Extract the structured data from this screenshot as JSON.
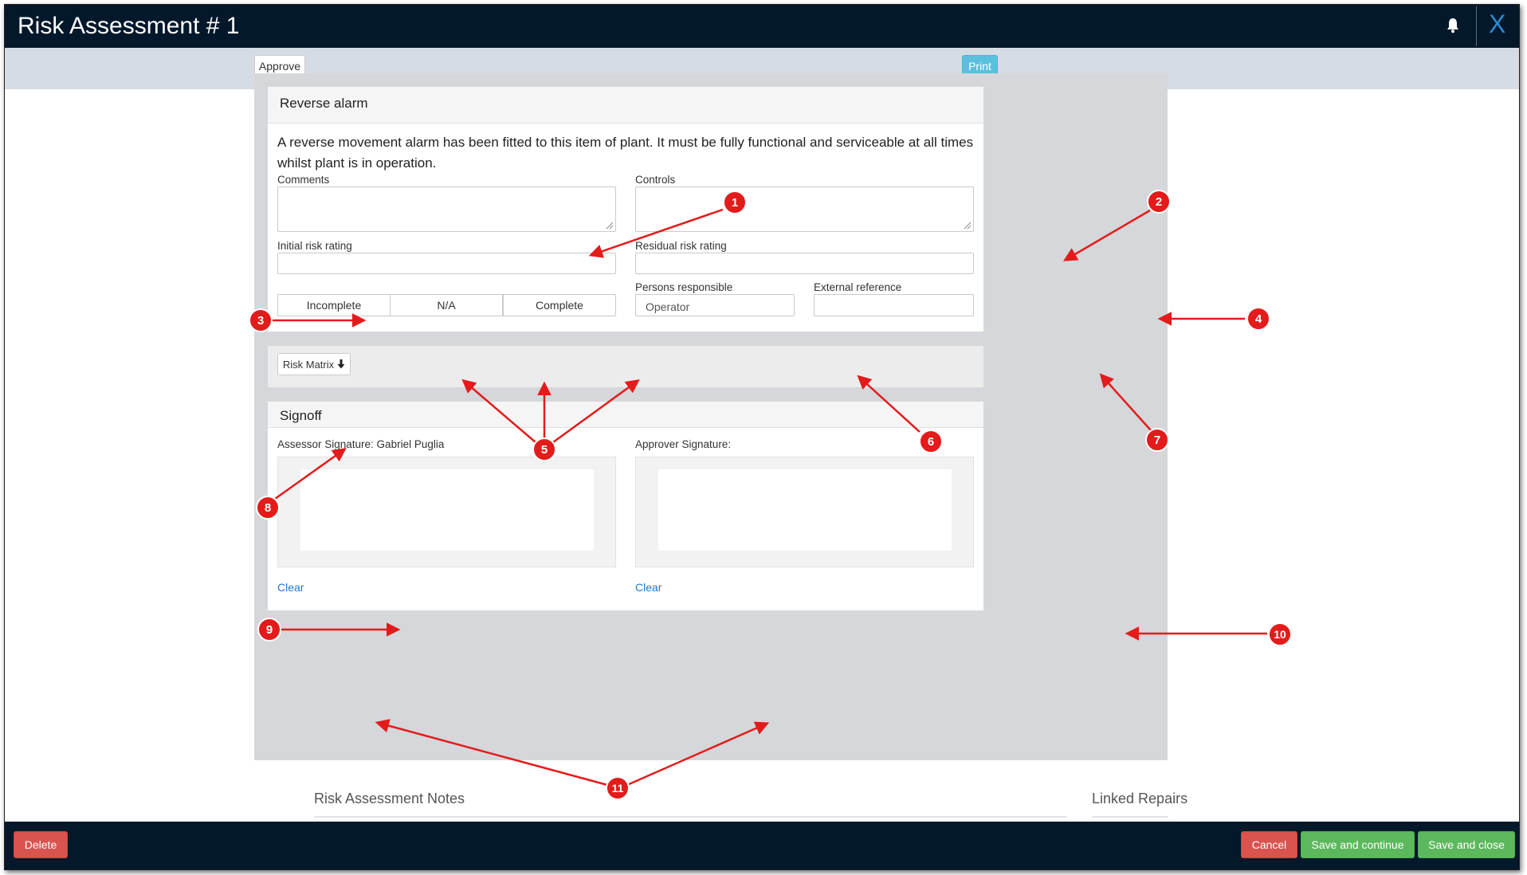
{
  "window": {
    "title": "Risk Assessment # 1",
    "close_label": "X"
  },
  "toolbar": {
    "approve_label": "Approve",
    "print_label": "Print"
  },
  "hazard": {
    "title": "Reverse alarm",
    "description": "A reverse movement alarm has been fitted to this item of plant. It must be fully functional and serviceable at all times whilst plant is in operation.",
    "comments_label": "Comments",
    "controls_label": "Controls",
    "initial_label": "Initial risk rating",
    "residual_label": "Residual risk rating",
    "status_options": [
      "Incomplete",
      "N/A",
      "Complete"
    ],
    "persons_label": "Persons responsible",
    "persons_value": "Operator",
    "external_label": "External reference"
  },
  "risk_matrix": {
    "label": "Risk Matrix"
  },
  "signoff": {
    "title": "Signoff",
    "assessor_label": "Assessor Signature: Gabriel Puglia",
    "approver_label": "Approver Signature:",
    "clear_label": "Clear"
  },
  "notes": {
    "title": "Risk Assessment Notes"
  },
  "linked": {
    "title": "Linked Repairs"
  },
  "footer": {
    "delete_label": "Delete",
    "cancel_label": "Cancel",
    "save_continue_label": "Save and continue",
    "save_close_label": "Save and close"
  },
  "annotations": [
    "1",
    "2",
    "3",
    "4",
    "5",
    "6",
    "7",
    "8",
    "9",
    "10",
    "11"
  ],
  "colors": {
    "navbar": "#04182b",
    "toolbar": "#d6dce3",
    "panel": "#d5d7da",
    "print": "#5bc0de",
    "danger": "#d9534f",
    "success": "#5cb85c",
    "link": "#1e7ad1",
    "annotation": "#e41b1b"
  }
}
